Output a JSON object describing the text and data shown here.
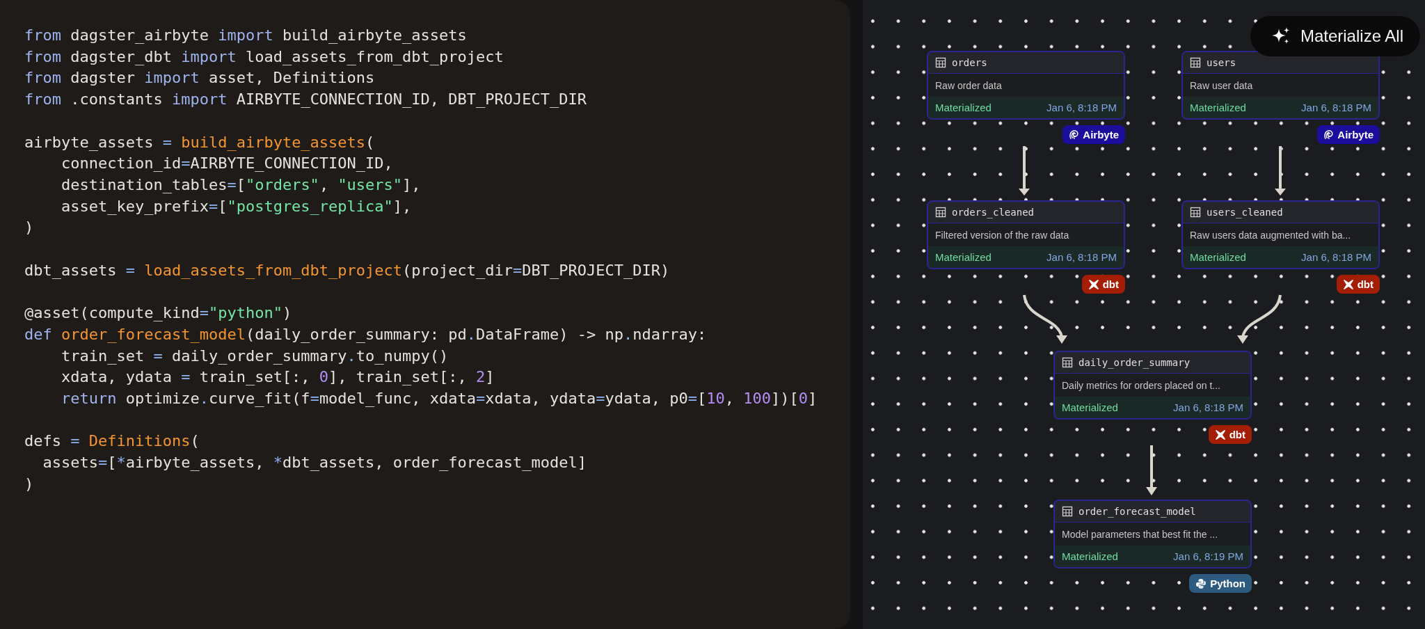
{
  "code_blocks": [
    [
      [
        {
          "kind": "kw",
          "text": "from"
        },
        {
          "kind": "plain",
          "text": " dagster_airbyte "
        },
        {
          "kind": "kw",
          "text": "import"
        },
        {
          "kind": "plain",
          "text": " build_airbyte_assets"
        }
      ],
      [
        {
          "kind": "kw",
          "text": "from"
        },
        {
          "kind": "plain",
          "text": " dagster_dbt "
        },
        {
          "kind": "kw",
          "text": "import"
        },
        {
          "kind": "plain",
          "text": " load_assets_from_dbt_project"
        }
      ],
      [
        {
          "kind": "kw",
          "text": "from"
        },
        {
          "kind": "plain",
          "text": " dagster "
        },
        {
          "kind": "kw",
          "text": "import"
        },
        {
          "kind": "plain",
          "text": " asset, Definitions"
        }
      ],
      [
        {
          "kind": "kw",
          "text": "from"
        },
        {
          "kind": "plain",
          "text": " .constants "
        },
        {
          "kind": "kw",
          "text": "import"
        },
        {
          "kind": "plain",
          "text": " AIRBYTE_CONNECTION_ID, DBT_PROJECT_DIR"
        }
      ]
    ],
    [
      [
        {
          "kind": "plain",
          "text": "airbyte_assets "
        },
        {
          "kind": "op",
          "text": "= "
        },
        {
          "kind": "fn",
          "text": "build_airbyte_assets"
        },
        {
          "kind": "plain",
          "text": "("
        }
      ],
      [
        {
          "kind": "plain",
          "text": "    connection_id"
        },
        {
          "kind": "op",
          "text": "="
        },
        {
          "kind": "plain",
          "text": "AIRBYTE_CONNECTION_ID,"
        }
      ],
      [
        {
          "kind": "plain",
          "text": "    destination_tables"
        },
        {
          "kind": "op",
          "text": "="
        },
        {
          "kind": "plain",
          "text": "["
        },
        {
          "kind": "str",
          "text": "\"orders\""
        },
        {
          "kind": "plain",
          "text": ", "
        },
        {
          "kind": "str",
          "text": "\"users\""
        },
        {
          "kind": "plain",
          "text": "],"
        }
      ],
      [
        {
          "kind": "plain",
          "text": "    asset_key_prefix"
        },
        {
          "kind": "op",
          "text": "="
        },
        {
          "kind": "plain",
          "text": "["
        },
        {
          "kind": "str",
          "text": "\"postgres_replica\""
        },
        {
          "kind": "plain",
          "text": "],"
        }
      ],
      [
        {
          "kind": "plain",
          "text": ")"
        }
      ]
    ],
    [
      [
        {
          "kind": "plain",
          "text": "dbt_assets "
        },
        {
          "kind": "op",
          "text": "= "
        },
        {
          "kind": "fn",
          "text": "load_assets_from_dbt_project"
        },
        {
          "kind": "plain",
          "text": "(project_dir"
        },
        {
          "kind": "op",
          "text": "="
        },
        {
          "kind": "plain",
          "text": "DBT_PROJECT_DIR)"
        }
      ]
    ],
    [
      [
        {
          "kind": "plain",
          "text": "@asset(compute_kind"
        },
        {
          "kind": "op",
          "text": "="
        },
        {
          "kind": "str",
          "text": "\"python\""
        },
        {
          "kind": "plain",
          "text": ")"
        }
      ],
      [
        {
          "kind": "kw",
          "text": "def "
        },
        {
          "kind": "fn",
          "text": "order_forecast_model"
        },
        {
          "kind": "plain",
          "text": "(daily_order_summary: pd"
        },
        {
          "kind": "op",
          "text": "."
        },
        {
          "kind": "plain",
          "text": "DataFrame) -> np"
        },
        {
          "kind": "op",
          "text": "."
        },
        {
          "kind": "plain",
          "text": "ndarray:"
        }
      ],
      [
        {
          "kind": "plain",
          "text": "    train_set "
        },
        {
          "kind": "op",
          "text": "="
        },
        {
          "kind": "plain",
          "text": " daily_order_summary"
        },
        {
          "kind": "op",
          "text": "."
        },
        {
          "kind": "plain",
          "text": "to_numpy()"
        }
      ],
      [
        {
          "kind": "plain",
          "text": "    xdata, ydata "
        },
        {
          "kind": "op",
          "text": "="
        },
        {
          "kind": "plain",
          "text": " train_set[:, "
        },
        {
          "kind": "num",
          "text": "0"
        },
        {
          "kind": "plain",
          "text": "], train_set[:, "
        },
        {
          "kind": "num",
          "text": "2"
        },
        {
          "kind": "plain",
          "text": "]"
        }
      ],
      [
        {
          "kind": "kw",
          "text": "    return"
        },
        {
          "kind": "plain",
          "text": " optimize"
        },
        {
          "kind": "op",
          "text": "."
        },
        {
          "kind": "plain",
          "text": "curve_fit(f"
        },
        {
          "kind": "op",
          "text": "="
        },
        {
          "kind": "plain",
          "text": "model_func, xdata"
        },
        {
          "kind": "op",
          "text": "="
        },
        {
          "kind": "plain",
          "text": "xdata, ydata"
        },
        {
          "kind": "op",
          "text": "="
        },
        {
          "kind": "plain",
          "text": "ydata, p0"
        },
        {
          "kind": "op",
          "text": "="
        },
        {
          "kind": "plain",
          "text": "["
        },
        {
          "kind": "num",
          "text": "10"
        },
        {
          "kind": "plain",
          "text": ", "
        },
        {
          "kind": "num",
          "text": "100"
        },
        {
          "kind": "plain",
          "text": "])["
        },
        {
          "kind": "num",
          "text": "0"
        },
        {
          "kind": "plain",
          "text": "]"
        }
      ]
    ],
    [
      [
        {
          "kind": "plain",
          "text": "defs "
        },
        {
          "kind": "op",
          "text": "= "
        },
        {
          "kind": "fn",
          "text": "Definitions"
        },
        {
          "kind": "plain",
          "text": "("
        }
      ],
      [
        {
          "kind": "plain",
          "text": "  assets"
        },
        {
          "kind": "op",
          "text": "="
        },
        {
          "kind": "plain",
          "text": "["
        },
        {
          "kind": "op",
          "text": "*"
        },
        {
          "kind": "plain",
          "text": "airbyte_assets, "
        },
        {
          "kind": "op",
          "text": "*"
        },
        {
          "kind": "plain",
          "text": "dbt_assets, order_forecast_model]"
        }
      ],
      [
        {
          "kind": "plain",
          "text": ")"
        }
      ]
    ]
  ],
  "graph": {
    "button": {
      "label": "Materialize All"
    },
    "nodes": [
      {
        "name": "orders",
        "description": "Raw order data",
        "status": "Materialized",
        "timestamp": "Jan 6, 8:18 PM",
        "tag": {
          "kind": "airbyte",
          "label": "Airbyte"
        }
      },
      {
        "name": "users",
        "description": "Raw user data",
        "status": "Materialized",
        "timestamp": "Jan 6, 8:18 PM",
        "tag": {
          "kind": "airbyte",
          "label": "Airbyte"
        }
      },
      {
        "name": "orders_cleaned",
        "description": "Filtered version of the raw data",
        "status": "Materialized",
        "timestamp": "Jan 6, 8:18 PM",
        "tag": {
          "kind": "dbt",
          "label": "dbt"
        }
      },
      {
        "name": "users_cleaned",
        "description": "Raw users data augmented with ba...",
        "status": "Materialized",
        "timestamp": "Jan 6, 8:18 PM",
        "tag": {
          "kind": "dbt",
          "label": "dbt"
        }
      },
      {
        "name": "daily_order_summary",
        "description": "Daily metrics for orders placed on t...",
        "status": "Materialized",
        "timestamp": "Jan 6, 8:18 PM",
        "tag": {
          "kind": "dbt",
          "label": "dbt"
        }
      },
      {
        "name": "order_forecast_model",
        "description": "Model parameters that best fit the ...",
        "status": "Materialized",
        "timestamp": "Jan 6, 8:19 PM",
        "tag": {
          "kind": "python",
          "label": "Python"
        }
      }
    ]
  }
}
